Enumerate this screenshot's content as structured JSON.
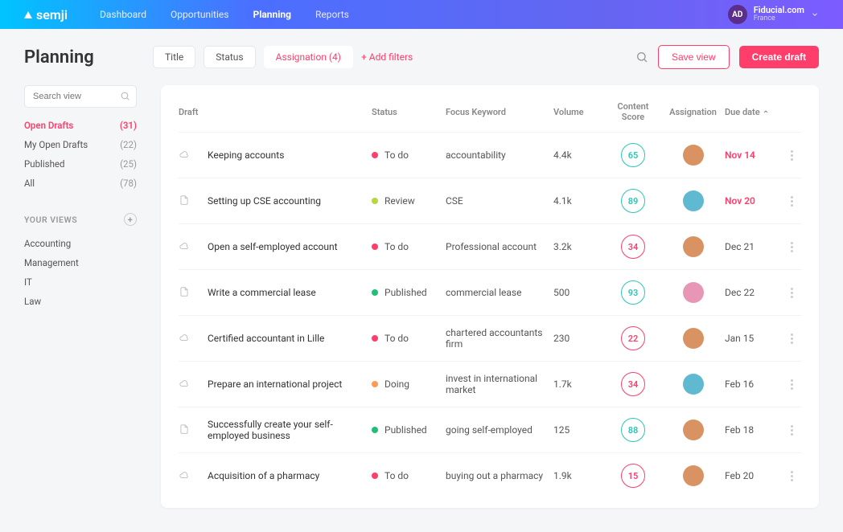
{
  "brand": "semji",
  "nav": [
    {
      "label": "Dashboard",
      "active": false
    },
    {
      "label": "Opportunities",
      "active": false
    },
    {
      "label": "Planning",
      "active": true
    },
    {
      "label": "Reports",
      "active": false
    }
  ],
  "account": {
    "badge": "AD",
    "name": "Fiducial.com",
    "sub": "France"
  },
  "page_title": "Planning",
  "filters": {
    "chips": [
      {
        "label": "Title",
        "active": false
      },
      {
        "label": "Status",
        "active": false
      },
      {
        "label": "Assignation (4)",
        "active": true
      }
    ],
    "add_label": "+ Add filters"
  },
  "actions": {
    "save_view": "Save view",
    "create_draft": "Create draft"
  },
  "sidebar": {
    "search_placeholder": "Search view",
    "default_views": [
      {
        "label": "Open Drafts",
        "count": "(31)",
        "active": true
      },
      {
        "label": "My Open Drafts",
        "count": "(22)",
        "active": false
      },
      {
        "label": "Published",
        "count": "(25)",
        "active": false
      },
      {
        "label": "All",
        "count": "(78)",
        "active": false
      }
    ],
    "your_views_label": "YOUR VIEWS",
    "your_views": [
      {
        "label": "Accounting"
      },
      {
        "label": "Management"
      },
      {
        "label": "IT"
      },
      {
        "label": "Law"
      }
    ]
  },
  "columns": {
    "draft": "Draft",
    "status": "Status",
    "keyword": "Focus Keyword",
    "volume": "Volume",
    "score": "Content Score",
    "assign": "Assignation",
    "due": "Due date"
  },
  "status_colors": {
    "To do": "#ff3e6c",
    "Review": "#b5d93c",
    "Published": "#1fbf75",
    "Doing": "#ff9a55"
  },
  "avatar_colors": [
    "#d99262",
    "#5fb9d1",
    "#d99262",
    "#e896b6",
    "#d99262",
    "#5fb9d1",
    "#d99262",
    "#d99262"
  ],
  "rows": [
    {
      "icon": "cloud",
      "title": "Keeping accounts",
      "status": "To do",
      "keyword": "accountability",
      "volume": "4.4k",
      "score": 65,
      "score_tone": "teal",
      "due": "Nov 14",
      "overdue": true
    },
    {
      "icon": "file",
      "title": "Setting up CSE accounting",
      "status": "Review",
      "keyword": "CSE",
      "volume": "4.1k",
      "score": 89,
      "score_tone": "teal",
      "due": "Nov 20",
      "overdue": true
    },
    {
      "icon": "cloud",
      "title": "Open a self-employed account",
      "status": "To do",
      "keyword": "Professional account",
      "volume": "3.2k",
      "score": 34,
      "score_tone": "red",
      "due": "Dec 21",
      "overdue": false
    },
    {
      "icon": "file",
      "title": "Write a commercial lease",
      "status": "Published",
      "keyword": "commercial lease",
      "volume": "500",
      "score": 93,
      "score_tone": "teal",
      "due": "Dec 22",
      "overdue": false
    },
    {
      "icon": "cloud",
      "title": "Certified accountant in Lille",
      "status": "To do",
      "keyword": "chartered accountants firm",
      "volume": "230",
      "score": 22,
      "score_tone": "red",
      "due": "Jan 15",
      "overdue": false
    },
    {
      "icon": "cloud",
      "title": "Prepare an international project",
      "status": "Doing",
      "keyword": "invest in international market",
      "volume": "1.7k",
      "score": 34,
      "score_tone": "red",
      "due": "Feb 16",
      "overdue": false
    },
    {
      "icon": "file",
      "title": "Successfully create your self-employed business",
      "status": "Published",
      "keyword": "going self-employed",
      "volume": "125",
      "score": 88,
      "score_tone": "teal",
      "due": "Feb 18",
      "overdue": false
    },
    {
      "icon": "cloud",
      "title": "Acquisition of a pharmacy",
      "status": "To do",
      "keyword": "buying out a pharmacy",
      "volume": "1.9k",
      "score": 15,
      "score_tone": "red",
      "due": "Feb 20",
      "overdue": false
    }
  ]
}
